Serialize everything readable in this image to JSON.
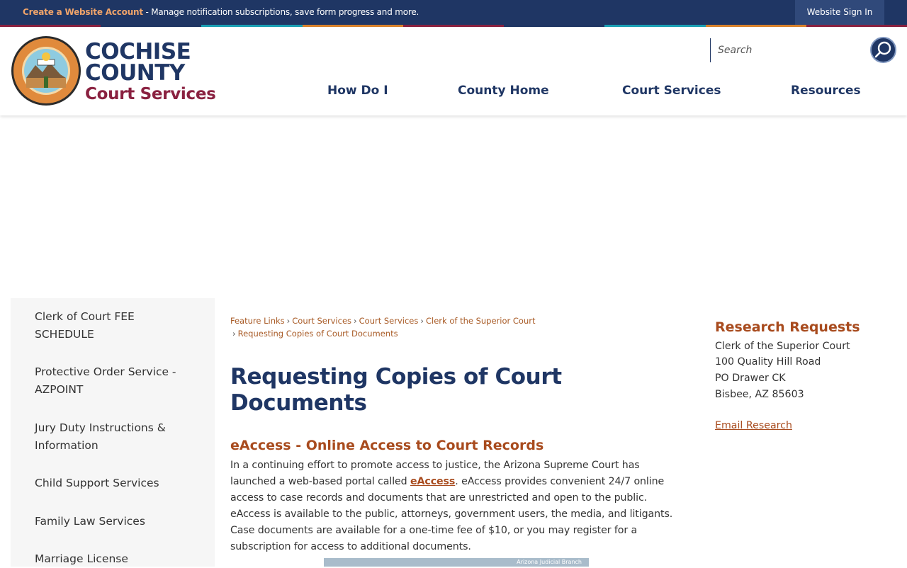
{
  "topbar": {
    "create_account_label": "Create a Website Account",
    "create_account_desc": " - Manage notification subscriptions, save form progress and more.",
    "signin_label": "Website Sign In"
  },
  "stripe_colors": [
    "#8a2140",
    "#1f3664",
    "#1aa0b5",
    "#d9822b",
    "#8a2140",
    "#1f3664",
    "#1aa0b5",
    "#d9822b",
    "#8a2140"
  ],
  "logo": {
    "line1": "COCHISE",
    "line2": "COUNTY",
    "line3": "Court Services"
  },
  "search": {
    "placeholder": "Search"
  },
  "nav": [
    {
      "label": "How Do I"
    },
    {
      "label": "County Home"
    },
    {
      "label": "Court Services"
    },
    {
      "label": "Resources"
    }
  ],
  "sidebar": {
    "items": [
      {
        "label": "Clerk of Court FEE SCHEDULE"
      },
      {
        "label": "Protective Order Service - AZPOINT"
      },
      {
        "label": "Jury Duty Instructions & Information"
      },
      {
        "label": "Child Support Services"
      },
      {
        "label": "Family Law Services"
      },
      {
        "label": "Marriage License"
      }
    ]
  },
  "breadcrumb": {
    "items": [
      "Feature Links",
      "Court Services",
      "Court Services",
      "Clerk of the Superior Court",
      "Requesting Copies of Court Documents"
    ]
  },
  "main": {
    "title": "Requesting Copies of Court Documents",
    "section_title": "eAccess - Online Access to Court Records",
    "body_before_link": "In a continuing effort to promote access to justice, the Arizona Supreme Court has launched a web-based portal called ",
    "body_link": "eAccess",
    "body_after_link": ". eAccess provides convenient 24/7 online access to case records and documents that are unrestricted and open to the public. eAccess is available to the public, attorneys, government users, the media, and litigants. Case documents are available for a one-time fee of $10, or you may register for a subscription for access to additional documents.",
    "image_caption": "Arizona Judicial Branch"
  },
  "research": {
    "title": "Research Requests",
    "lines": [
      "Clerk of the Superior Court",
      "100 Quality Hill Road",
      "PO Drawer CK",
      "Bisbee, AZ 85603"
    ],
    "email_label": "Email Research "
  }
}
